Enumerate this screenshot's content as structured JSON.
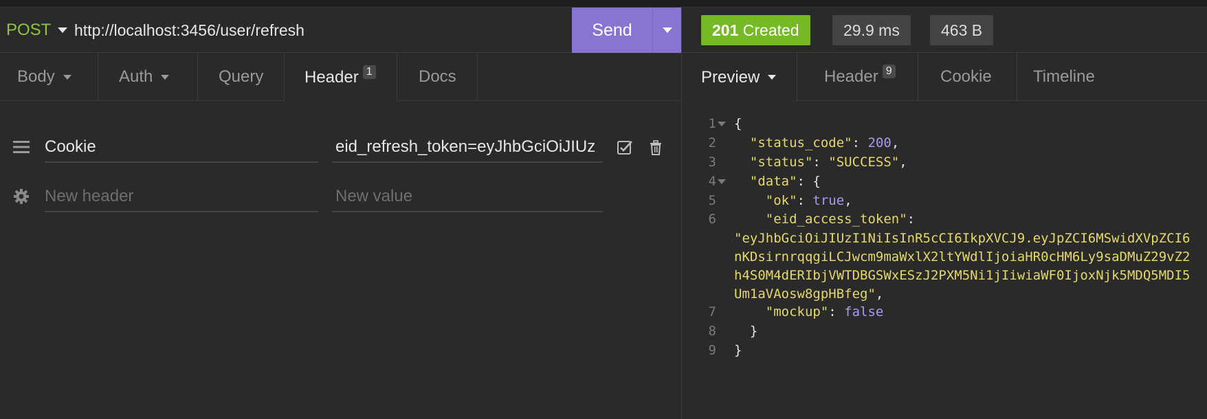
{
  "request": {
    "method": "POST",
    "url": "http://localhost:3456/user/refresh",
    "send_label": "Send",
    "tabs": [
      {
        "label": "Body"
      },
      {
        "label": "Auth"
      },
      {
        "label": "Query"
      },
      {
        "label": "Header",
        "badge": "1"
      },
      {
        "label": "Docs"
      }
    ],
    "headers": [
      {
        "name": "Cookie",
        "value": "eid_refresh_token=eyJhbGciOiJIUz"
      }
    ],
    "new_header_placeholder": "New header",
    "new_value_placeholder": "New value"
  },
  "response": {
    "status_code": "201",
    "status_text": "Created",
    "time": "29.9 ms",
    "size": "463 B",
    "tabs": [
      {
        "label": "Preview"
      },
      {
        "label": "Header",
        "badge": "9"
      },
      {
        "label": "Cookie"
      },
      {
        "label": "Timeline"
      }
    ],
    "line_numbers": [
      "1",
      "2",
      "3",
      "4",
      "5",
      "6",
      "7",
      "8",
      "9"
    ],
    "json": {
      "k_status_code": "\"status_code\"",
      "v_status_code": "200",
      "k_status": "\"status\"",
      "v_status": "\"SUCCESS\"",
      "k_data": "\"data\"",
      "k_ok": "\"ok\"",
      "v_ok": "true",
      "k_token": "\"eid_access_token\"",
      "token_lines": [
        "\"eyJhbGciOiJIUzI1NiIsInR5cCI6IkpXVCJ9.eyJpZCI6MSwidXVpZCI6",
        "nKDsirnrqqgiLCJwcm9maWxlX2ltYWdlIjoiaHR0cHM6Ly9saDMuZ29vZ2",
        "h4S0M4dERIbjVWTDBGSWxESzJ2PXM5Ni1jIiwiaWF0IjoxNjk5MDQ5MDI5",
        "Um1aVAosw8gpHBfeg\""
      ],
      "k_mockup": "\"mockup\"",
      "v_mockup": "false"
    }
  },
  "colors": {
    "accent": "#8a74d1",
    "method": "#8dc63f",
    "status_ok": "#75ba24",
    "json_string": "#e5d86a",
    "json_literal": "#a89cf0"
  }
}
